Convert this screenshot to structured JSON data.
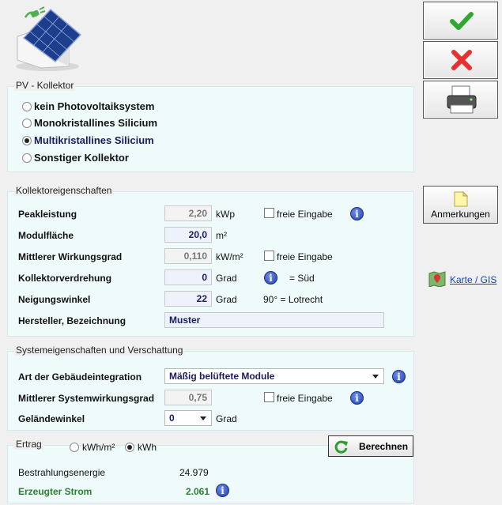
{
  "toolbar": {
    "ok_icon": "green-check-icon",
    "cancel_icon": "red-x-icon",
    "print_icon": "printer-icon",
    "notes_label": "Anmerkungen",
    "map_link": "Karte / GIS"
  },
  "pv_kollektor": {
    "legend": "PV - Kollektor",
    "options": [
      {
        "label": "kein Photovoltaiksystem",
        "selected": false
      },
      {
        "label": "Monokristallines Silicium",
        "selected": false
      },
      {
        "label": "Multikristallines Silicium",
        "selected": true
      },
      {
        "label": "Sonstiger Kollektor",
        "selected": false
      }
    ]
  },
  "kollektor": {
    "legend": "Kollektoreigenschaften",
    "peak_label": "Peakleistung",
    "peak_value": "2,20",
    "peak_unit": "kWp",
    "peak_free": "freie Eingabe",
    "area_label": "Modulfläche",
    "area_value": "20,0",
    "area_unit": "m²",
    "eff_label": "Mittlerer Wirkungsgrad",
    "eff_value": "0,110",
    "eff_unit": "kW/m²",
    "eff_free": "freie Eingabe",
    "rot_label": "Kollektorverdrehung",
    "rot_value": "0",
    "rot_unit": "Grad",
    "rot_hint": "= Süd",
    "tilt_label": "Neigungswinkel",
    "tilt_value": "22",
    "tilt_unit": "Grad",
    "tilt_hint": "90° = Lotrecht",
    "maker_label": "Hersteller, Bezeichnung",
    "maker_value": "Muster"
  },
  "system": {
    "legend": "Systemeigenschaften und Verschattung",
    "integ_label": "Art der Gebäudeintegration",
    "integ_value": "Mäßig belüftete Module",
    "syseff_label": "Mittlerer Systemwirkungsgrad",
    "syseff_value": "0,75",
    "syseff_free": "freie Eingabe",
    "terrain_label": "Geländewinkel",
    "terrain_value": "0",
    "terrain_unit": "Grad"
  },
  "ertrag": {
    "legend": "Ertrag",
    "unit_opt1": "kWh/m²",
    "unit_opt2": "kWh",
    "unit_selected": "kWh",
    "calc_button": "Berechnen",
    "irr_label": "Bestrahlungsenergie",
    "irr_value": "24.979",
    "power_label": "Erzeugter Strom",
    "power_value": "2.061"
  },
  "colors": {
    "panel_bg": "#effafa",
    "value_blue": "#1b1b5e",
    "power_green": "#2e7d32",
    "link_blue": "#1a3fb5"
  }
}
